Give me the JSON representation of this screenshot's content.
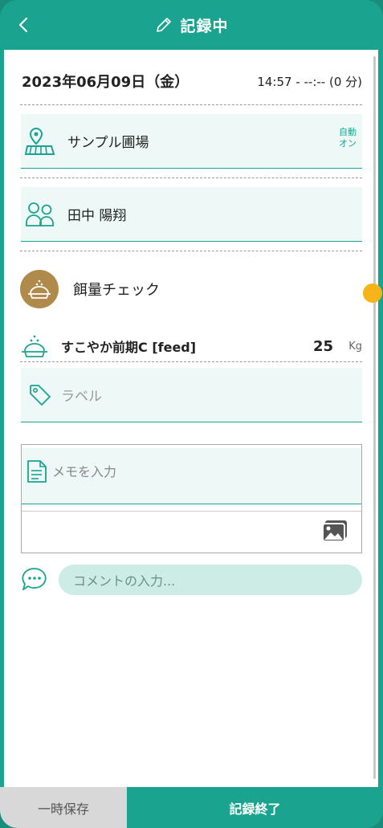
{
  "header": {
    "title": "記録中",
    "back_icon": "chevron-left-icon",
    "title_icon": "pencil-icon"
  },
  "record": {
    "date": "2023年06月09日（金）",
    "time": "14:57 - --:-- (0 分)"
  },
  "farm": {
    "name": "サンプル圃場",
    "auto_label_1": "自動",
    "auto_label_2": "オン",
    "icon": "map-pin-field-icon"
  },
  "workers": {
    "name": "田中 陽翔",
    "icon": "people-icon"
  },
  "category": {
    "label": "餌量チェック",
    "icon": "feed-bowl-icon"
  },
  "item": {
    "name": "すこやか前期C [feed]",
    "value": "25",
    "unit": "Kg",
    "icon": "feed-bowl-icon"
  },
  "label_field": {
    "placeholder": "ラベル",
    "icon": "tag-icon"
  },
  "memo": {
    "placeholder": "メモを入力",
    "icon": "document-icon",
    "image_icon": "image-gallery-icon"
  },
  "comment": {
    "placeholder": "コメントの入力...",
    "icon": "chat-bubble-icon"
  },
  "footer": {
    "save_label": "一時保存",
    "finish_label": "記録終了"
  },
  "colors": {
    "accent": "#1aa48f",
    "field_bg": "#eef8f6",
    "category_circle": "#b08a4a",
    "handle": "#f7b418"
  }
}
